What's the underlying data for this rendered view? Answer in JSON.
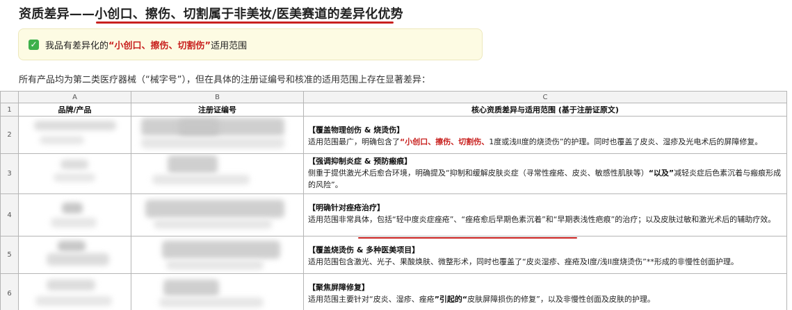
{
  "title": "资质差异——小创口、擦伤、切割属于非美妆/医美赛道的差异化优势",
  "note": {
    "prefix": "我品有差异化的",
    "highlight": "“小创口、擦伤、切割伤”",
    "suffix": "适用范围"
  },
  "intro": "所有产品均为第二类医疗器械（“械字号”），但在具体的注册证编号和核准的适用范围上存在显著差异：",
  "sheet": {
    "columns": [
      "A",
      "B",
      "C"
    ],
    "header": {
      "a": "品牌/产品",
      "b": "注册证编号",
      "c": "核心资质差异与适用范围 (基于注册证原文)"
    },
    "rows": [
      {
        "num": "2",
        "heading": "【覆盖物理创伤 & 烧烫伤】",
        "lines": [
          {
            "pre": "适用范围最广，",
            "mark": "明确包含了",
            "red": "“小创口、擦伤、切割伤、",
            "mark2": "1度或浅II度的烧烫伤”的护理",
            "post": "。同时也覆盖了皮炎、湿疹及光电术后的屏障修复。"
          }
        ]
      },
      {
        "num": "3",
        "heading": "【强调抑制炎症 & 预防瘢痕】",
        "body1": "侧重于提供激光术后愈合环境，明确提及“抑制和缓解皮肤炎症（寻常性痤疮、皮炎、敏感性肌肤等）",
        "strong": "“以及”",
        "body2": "减轻炎症后色素沉着与瘢痕形成的风险”。"
      },
      {
        "num": "4",
        "heading": "【明确针对痤疮治疗】",
        "body": "适用范围非常具体，包括“轻中度炎症痤疮”、“痤疮愈后早期色素沉着”和“早期表浅性疤痕”的治疗；以及皮肤过敏和激光术后的辅助疗效。"
      },
      {
        "num": "5",
        "heading": "【覆盖烧烫伤 & 多种医美项目】",
        "body": "适用范围包含激光、光子、果酸焕肤、微整形术，同时也覆盖了“皮炎湿疹、痤疮及I度/浅II度烧烫伤”**形成的非慢性创面护理。"
      },
      {
        "num": "6",
        "heading": "【聚焦屏障修复】",
        "body1": "适用范围主要针对“皮炎、湿疹、痤疮",
        "strong": "”引起的“",
        "body2": "皮肤屏障损伤的修复”，以及非慢性创面及皮肤的护理。"
      }
    ]
  },
  "colors": {
    "accent_red": "#c8201e",
    "note_bg": "#fdfbe3",
    "check_green": "#3db04b"
  }
}
